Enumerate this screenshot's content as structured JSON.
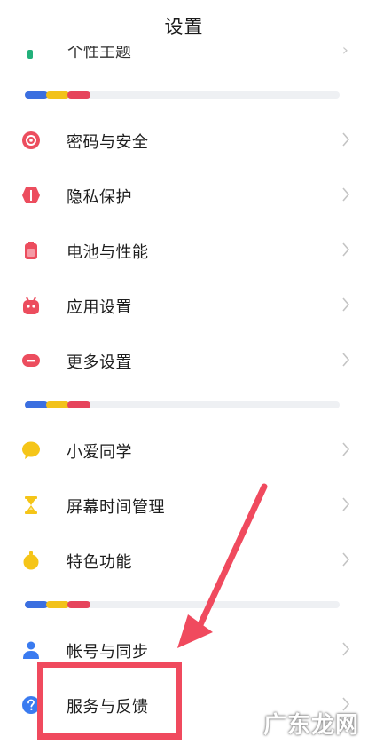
{
  "header": {
    "title": "设置"
  },
  "ghost_item": {
    "label": "个性主题"
  },
  "groups": [
    {
      "items": [
        {
          "key": "password",
          "label": "密码与安全",
          "icon": "password-security-icon",
          "color": "#ec4d5e"
        },
        {
          "key": "privacy",
          "label": "隐私保护",
          "icon": "privacy-shield-icon",
          "color": "#ec4d5e"
        },
        {
          "key": "battery",
          "label": "电池与性能",
          "icon": "battery-icon",
          "color": "#ec4d5e"
        },
        {
          "key": "apps",
          "label": "应用设置",
          "icon": "app-settings-icon",
          "color": "#ec4d5e"
        },
        {
          "key": "more",
          "label": "更多设置",
          "icon": "more-settings-icon",
          "color": "#ec4d5e"
        }
      ]
    },
    {
      "items": [
        {
          "key": "xiaoai",
          "label": "小爱同学",
          "icon": "xiaoai-chat-icon",
          "color": "#f5c518"
        },
        {
          "key": "screentime",
          "label": "屏幕时间管理",
          "icon": "hourglass-icon",
          "color": "#f5c518"
        },
        {
          "key": "features",
          "label": "特色功能",
          "icon": "feature-bell-icon",
          "color": "#f5c518"
        }
      ]
    },
    {
      "items": [
        {
          "key": "account",
          "label": "帐号与同步",
          "icon": "account-user-icon",
          "color": "#3a7bf0"
        },
        {
          "key": "feedback",
          "label": "服务与反馈",
          "icon": "help-question-icon",
          "color": "#3a7bf0"
        }
      ]
    }
  ],
  "divider_colors": [
    "#3b6fe0",
    "#f2c21b",
    "#e6445c"
  ],
  "annotation": {
    "color": "#f04a5e"
  },
  "watermark": {
    "text": "广东龙网"
  }
}
